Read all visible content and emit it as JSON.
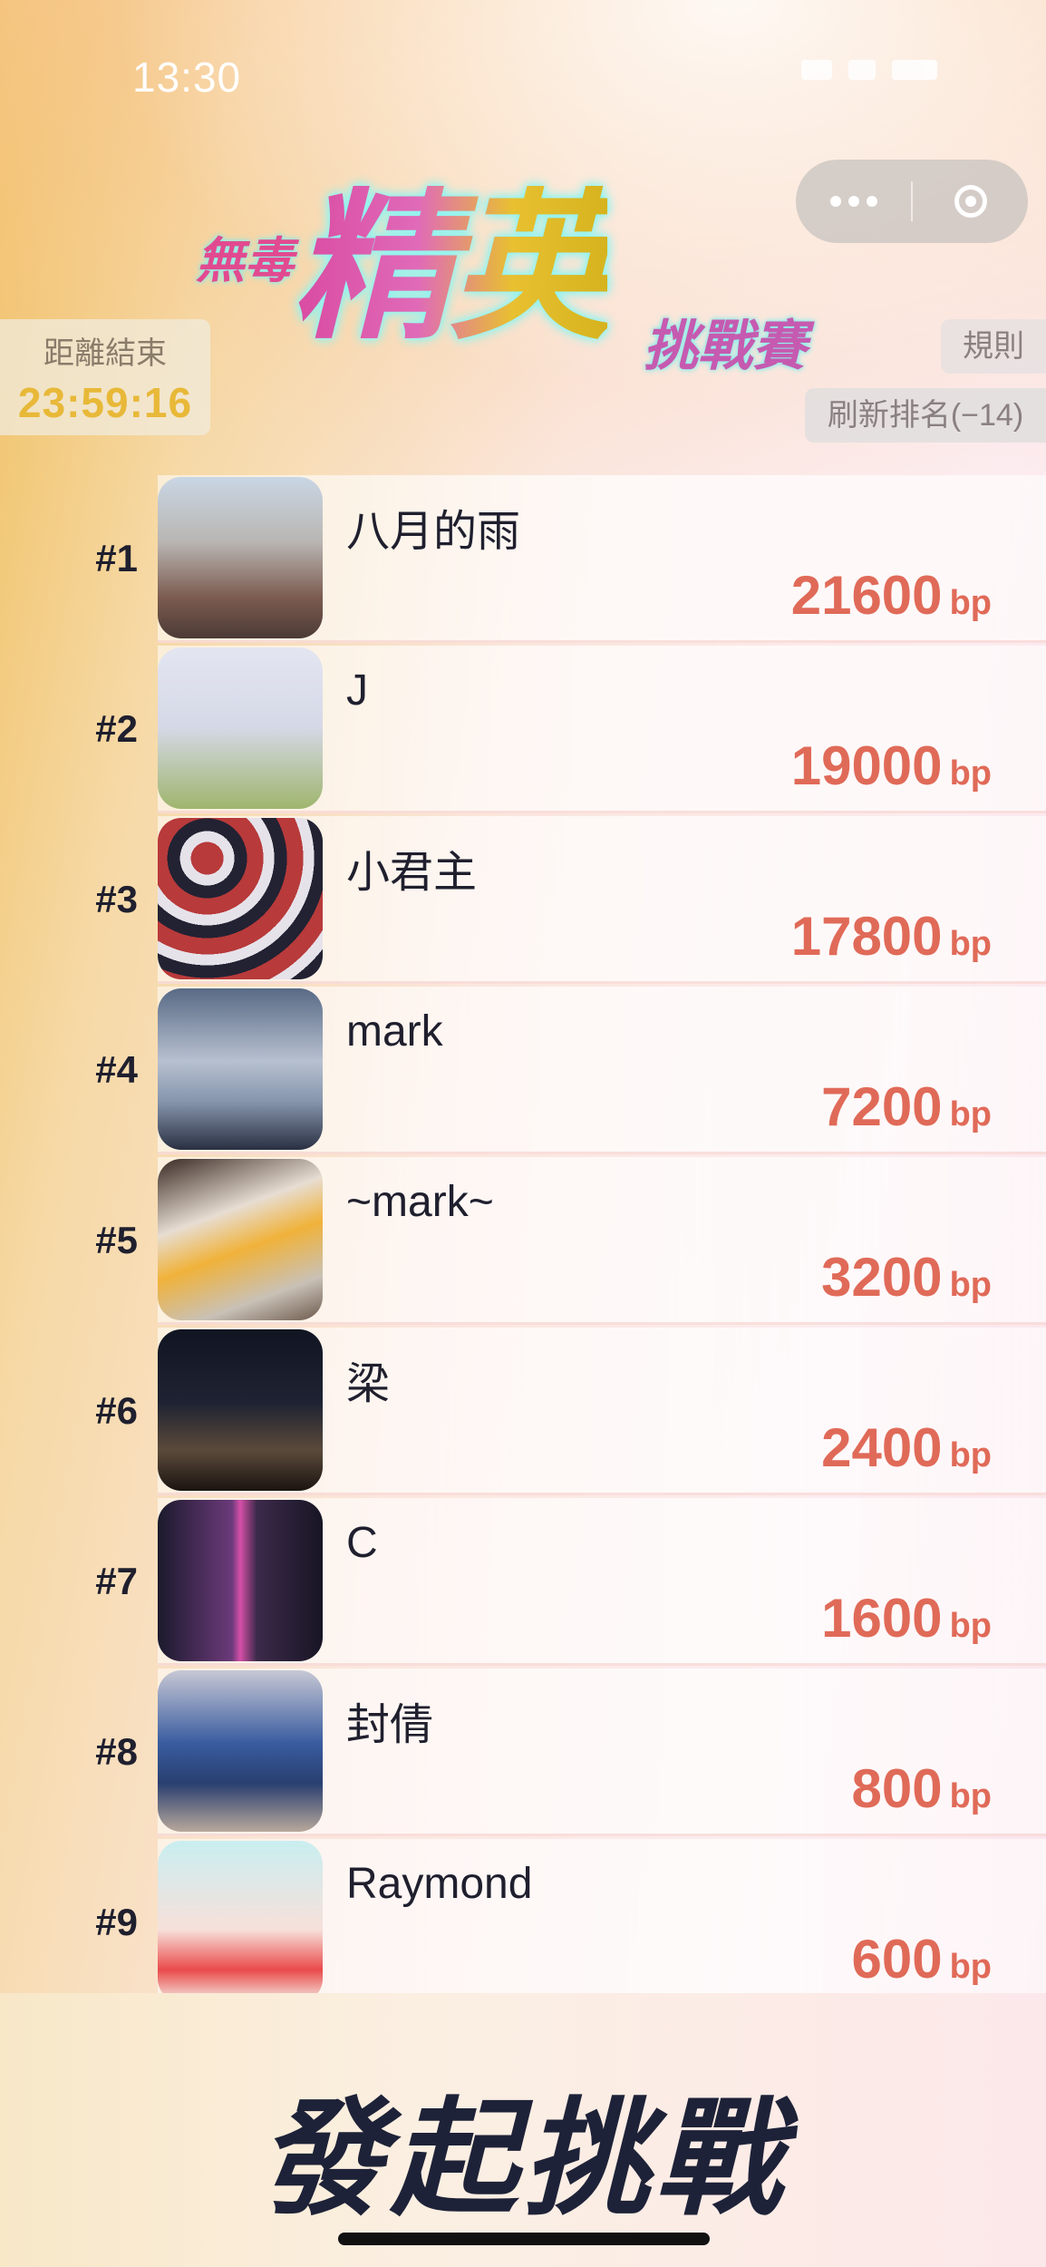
{
  "status_bar": {
    "time": "13:30"
  },
  "header": {
    "logo_prefix": "無毒",
    "logo_main": "精英",
    "logo_suffix": "挑戰賽"
  },
  "countdown": {
    "label": "距離結束",
    "time": "23:59:16"
  },
  "buttons": {
    "rules": "規則",
    "refresh": "刷新排名(−14)",
    "challenge": "發起挑戰"
  },
  "ranking": [
    {
      "rank": "#1",
      "name": "八月的雨",
      "score": "21600",
      "unit": "bp"
    },
    {
      "rank": "#2",
      "name": "J",
      "score": "19000",
      "unit": "bp"
    },
    {
      "rank": "#3",
      "name": "小君主",
      "score": "17800",
      "unit": "bp"
    },
    {
      "rank": "#4",
      "name": "mark",
      "score": "7200",
      "unit": "bp"
    },
    {
      "rank": "#5",
      "name": "~mark~",
      "score": "3200",
      "unit": "bp"
    },
    {
      "rank": "#6",
      "name": "梁",
      "score": "2400",
      "unit": "bp"
    },
    {
      "rank": "#7",
      "name": "C",
      "score": "1600",
      "unit": "bp"
    },
    {
      "rank": "#8",
      "name": "封倩",
      "score": "800",
      "unit": "bp"
    },
    {
      "rank": "#9",
      "name": "Raymond",
      "score": "600",
      "unit": "bp"
    }
  ],
  "icons": {
    "capsule_more": "more-dots-icon",
    "capsule_close": "close-miniprogram-icon"
  },
  "colors": {
    "score": "#e06a58",
    "countdown_time": "#e8b838",
    "rank_text": "#1f1f2e",
    "challenge_text": "#1e2238"
  }
}
